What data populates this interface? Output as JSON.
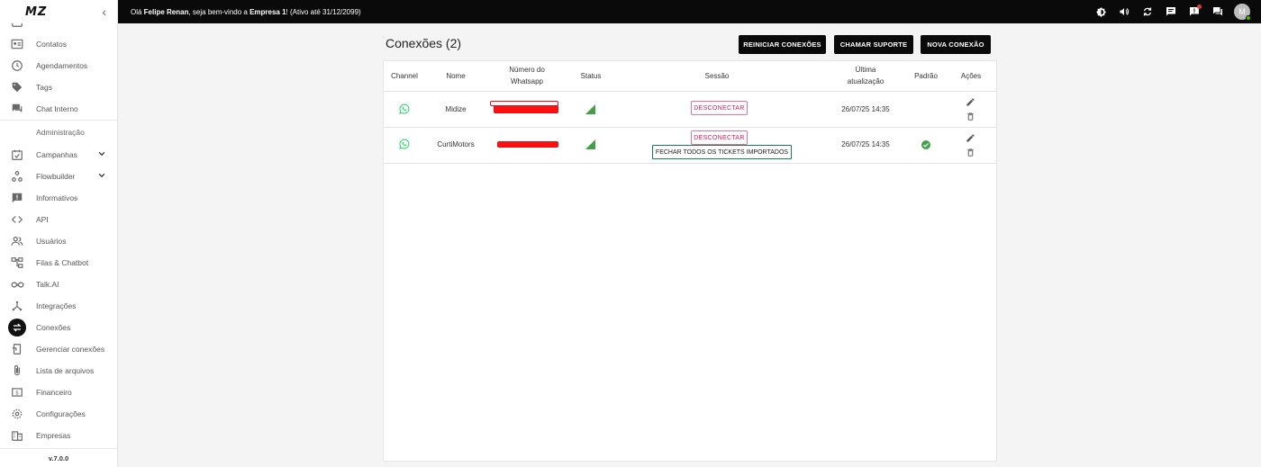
{
  "app": {
    "logo_text": "MZ",
    "version": "v.7.0.0"
  },
  "topbar": {
    "greeting_prefix": "Olá ",
    "user_name": "Felipe Renan",
    "greeting_middle": ", seja bem-vindo a ",
    "company": "Empresa 1",
    "status": "! (Ativo até 31/12/2099)",
    "avatar_initial": "M"
  },
  "sidebar": {
    "items": [
      {
        "label": "Contatos",
        "icon": "contacts-icon"
      },
      {
        "label": "Agendamentos",
        "icon": "clock-icon"
      },
      {
        "label": "Tags",
        "icon": "tag-icon"
      },
      {
        "label": "Chat Interno",
        "icon": "forum-icon"
      },
      {
        "label": "Campanhas",
        "icon": "event-icon"
      },
      {
        "label": "Flowbuilder",
        "icon": "flow-icon"
      },
      {
        "label": "Informativos",
        "icon": "announcement-icon"
      },
      {
        "label": "API",
        "icon": "code-icon"
      },
      {
        "label": "Usuários",
        "icon": "people-icon"
      },
      {
        "label": "Filas & Chatbot",
        "icon": "tree-icon"
      },
      {
        "label": "Talk.AI",
        "icon": "infinity-icon"
      },
      {
        "label": "Integrações",
        "icon": "hub-icon"
      },
      {
        "label": "Conexões",
        "icon": "swap-icon"
      },
      {
        "label": "Gerenciar conexões",
        "icon": "manage-icon"
      },
      {
        "label": "Lista de arquivos",
        "icon": "attach-icon"
      },
      {
        "label": "Financeiro",
        "icon": "money-icon"
      },
      {
        "label": "Configurações",
        "icon": "settings-icon"
      },
      {
        "label": "Empresas",
        "icon": "business-icon"
      }
    ],
    "admin_section": "Administração"
  },
  "main": {
    "title": "Conexões (2)",
    "buttons": {
      "restart": "REINICIAR CONEXÕES",
      "support": "CHAMAR SUPORTE",
      "new": "NOVA CONEXÃO"
    },
    "table": {
      "headers": {
        "channel": "Channel",
        "name": "Nome",
        "number_l1": "Número do",
        "number_l2": "Whatsapp",
        "status": "Status",
        "session": "Sessão",
        "updated_l1": "Última",
        "updated_l2": "atualização",
        "default": "Padrão",
        "actions": "Ações"
      },
      "rows": [
        {
          "name": "Midize",
          "session": "DESCONECTAR",
          "updated": "26/07/25 14:35",
          "is_default": false
        },
        {
          "name": "CurtiMotors",
          "session": "DESCONECTAR",
          "close_tickets": "FECHAR TODOS OS TICKETS IMPORTADOS",
          "updated": "26/07/25 14:35",
          "is_default": true
        }
      ]
    }
  },
  "colors": {
    "accent": "#0a0a0a",
    "whatsapp": "#25d366",
    "status_ok": "#43a047",
    "disconnect": "#d81b60"
  }
}
